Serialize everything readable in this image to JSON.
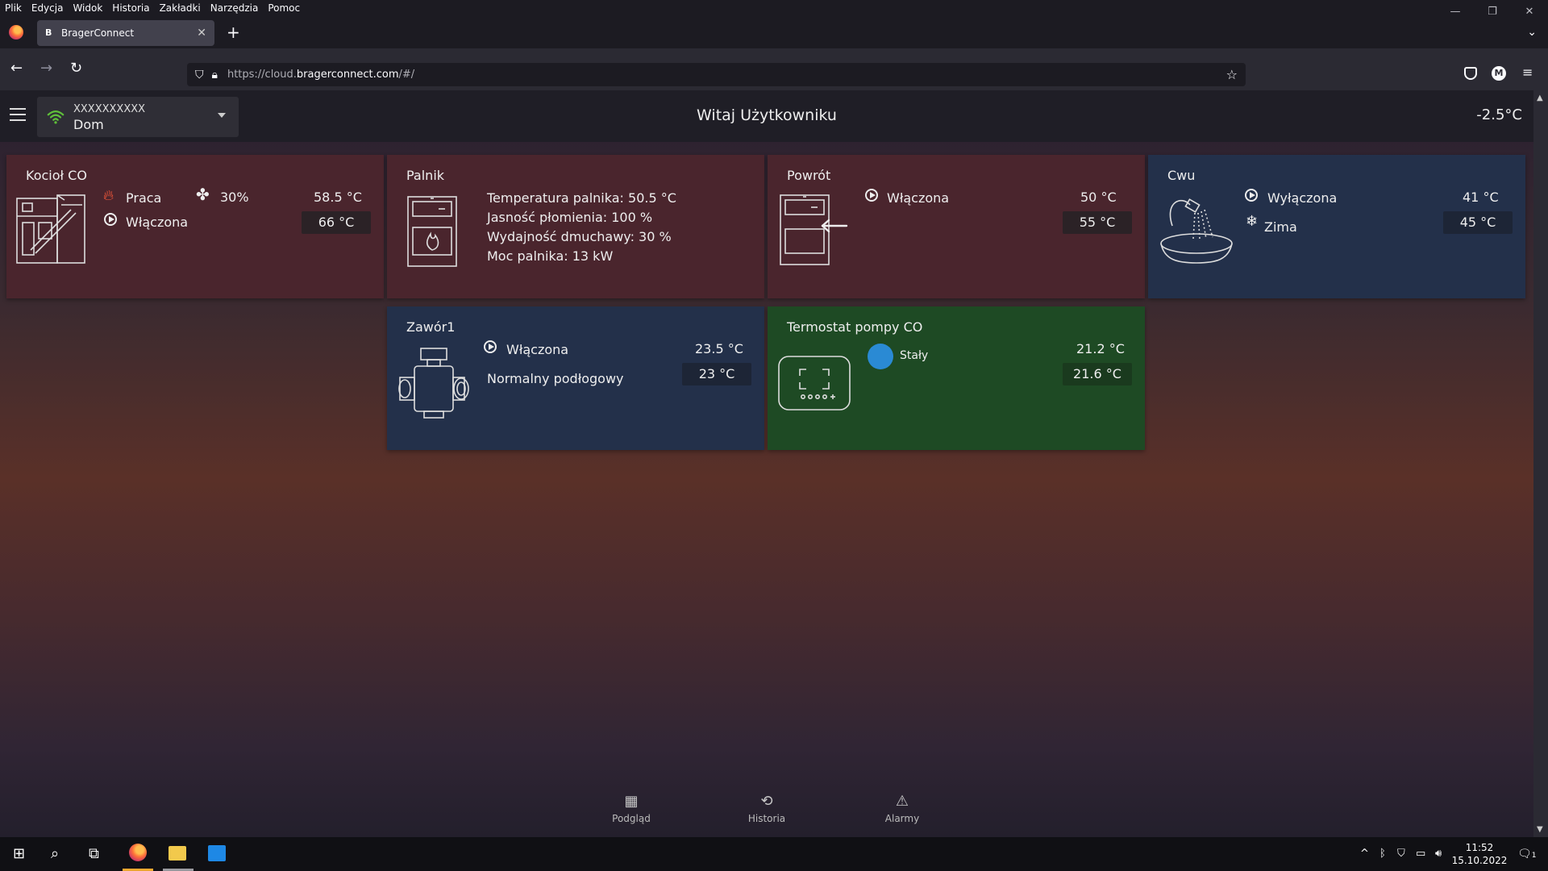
{
  "browser": {
    "menu": [
      "Plik",
      "Edycja",
      "Widok",
      "Historia",
      "Zakładki",
      "Narzędzia",
      "Pomoc"
    ],
    "tab_title": "BragerConnect",
    "tab_favicon": "B",
    "url_prefix": "https://cloud.",
    "url_domain": "bragerconnect.com",
    "url_suffix": "/#/",
    "account_initial": "M"
  },
  "header": {
    "device_id": "XXXXXXXXXX",
    "device_name": "Dom",
    "welcome": "Witaj Użytkowniku",
    "outdoor_temp": "-2.5°C"
  },
  "tiles": {
    "kociol": {
      "title": "Kocioł CO",
      "status": "Praca",
      "fan": "30%",
      "temp": "58.5 °C",
      "pump": "Włączona",
      "set": "66 °C",
      "color": "#4a252d"
    },
    "palnik": {
      "title": "Palnik",
      "lines": [
        "Temperatura palnika: 50.5 °C",
        "Jasność płomienia: 100 %",
        "Wydajność dmuchawy: 30 %",
        "Moc palnika: 13 kW"
      ]
    },
    "powrot": {
      "title": "Powrót",
      "pump": "Włączona",
      "temp": "50 °C",
      "set": "55 °C"
    },
    "cwu": {
      "title": "Cwu",
      "pump": "Wyłączona",
      "mode": "Zima",
      "temp": "41 °C",
      "set": "45 °C",
      "color": "#23304a"
    },
    "zawor": {
      "title": "Zawór1",
      "pump": "Włączona",
      "mode": "Normalny podłogowy",
      "temp": "23.5 °C",
      "set": "23 °C"
    },
    "termostat": {
      "title": "Termostat pompy CO",
      "mode": "Stały",
      "temp": "21.2 °C",
      "set": "21.6 °C",
      "indicator_color": "#2a8ad4",
      "color": "#1e4a24"
    }
  },
  "bottom_nav": [
    "Podgląd",
    "Historia",
    "Alarmy"
  ],
  "taskbar": {
    "time": "11:52",
    "date": "15.10.2022",
    "notifications": "1"
  }
}
